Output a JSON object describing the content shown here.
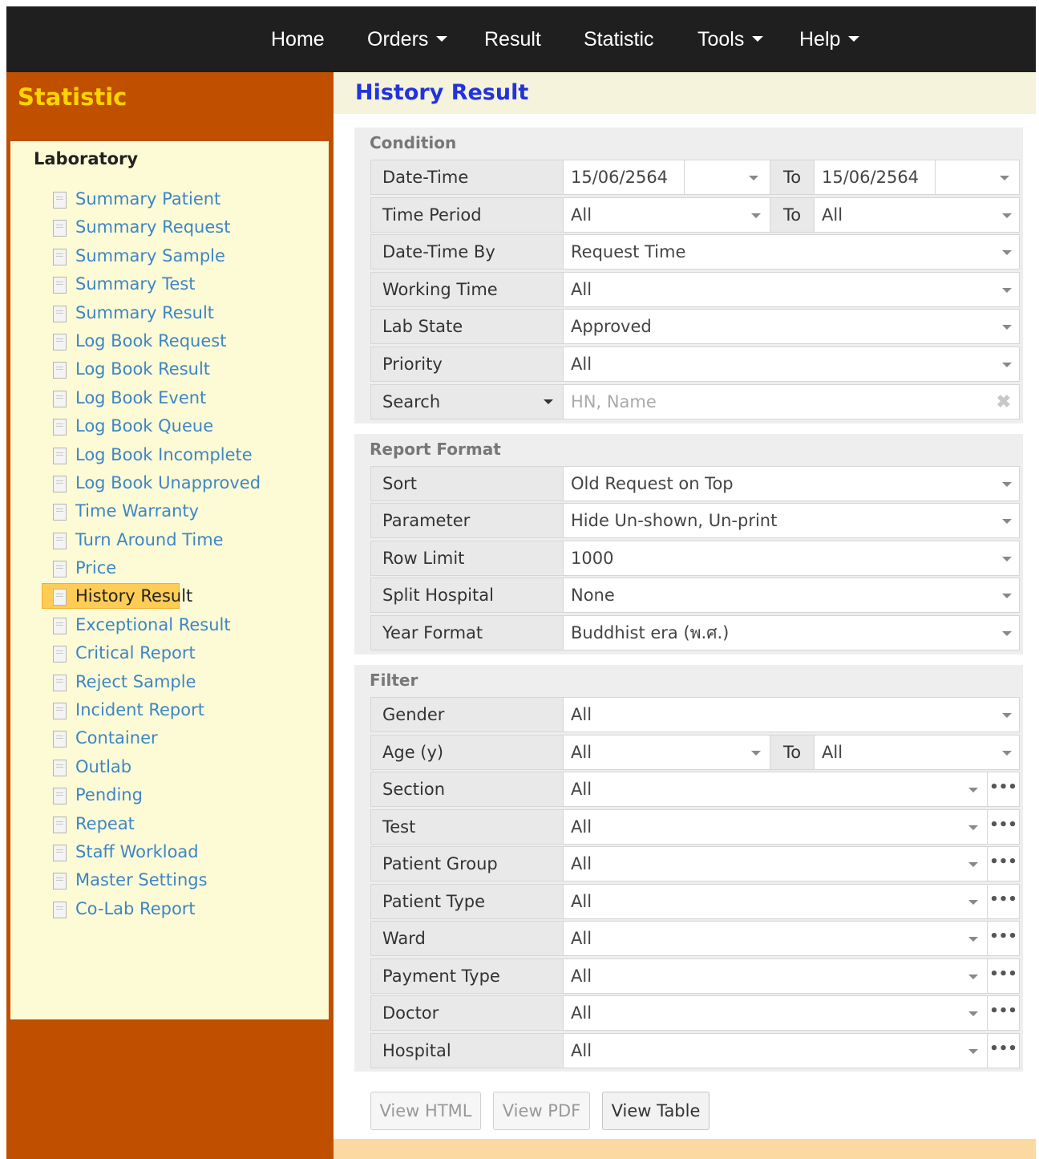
{
  "nav": {
    "items": [
      {
        "label": "Home",
        "has_menu": false
      },
      {
        "label": "Orders",
        "has_menu": true
      },
      {
        "label": "Result",
        "has_menu": false
      },
      {
        "label": "Statistic",
        "has_menu": false
      },
      {
        "label": "Tools",
        "has_menu": true
      },
      {
        "label": "Help",
        "has_menu": true
      }
    ]
  },
  "sidebar": {
    "title": "Statistic",
    "group_title": "Laboratory",
    "items": [
      {
        "label": "Summary Patient"
      },
      {
        "label": "Summary Request"
      },
      {
        "label": "Summary Sample"
      },
      {
        "label": "Summary Test"
      },
      {
        "label": "Summary Result"
      },
      {
        "label": "Log Book Request"
      },
      {
        "label": "Log Book Result"
      },
      {
        "label": "Log Book Event"
      },
      {
        "label": "Log Book Queue"
      },
      {
        "label": "Log Book Incomplete"
      },
      {
        "label": "Log Book Unapproved"
      },
      {
        "label": "Time Warranty"
      },
      {
        "label": "Turn Around Time"
      },
      {
        "label": "Price"
      },
      {
        "label": "History Result",
        "active": true
      },
      {
        "label": "Exceptional Result"
      },
      {
        "label": "Critical Report"
      },
      {
        "label": "Reject Sample"
      },
      {
        "label": "Incident Report"
      },
      {
        "label": "Container"
      },
      {
        "label": "Outlab"
      },
      {
        "label": "Pending"
      },
      {
        "label": "Repeat"
      },
      {
        "label": "Staff Workload"
      },
      {
        "label": "Master Settings"
      },
      {
        "label": "Co-Lab Report"
      }
    ]
  },
  "main": {
    "title": "History Result",
    "condition": {
      "title": "Condition",
      "date_time": {
        "label": "Date-Time",
        "from": "15/06/2564",
        "to_label": "To",
        "to": "15/06/2564"
      },
      "time_period": {
        "label": "Time Period",
        "from": "All",
        "to_label": "To",
        "to": "All"
      },
      "date_time_by": {
        "label": "Date-Time By",
        "value": "Request Time"
      },
      "working_time": {
        "label": "Working Time",
        "value": "All"
      },
      "lab_state": {
        "label": "Lab State",
        "value": "Approved"
      },
      "priority": {
        "label": "Priority",
        "value": "All"
      },
      "search": {
        "label": "Search",
        "placeholder": "HN, Name",
        "clear": "✖"
      }
    },
    "report_format": {
      "title": "Report Format",
      "sort": {
        "label": "Sort",
        "value": "Old Request on Top"
      },
      "parameter": {
        "label": "Parameter",
        "value": "Hide Un-shown, Un-print"
      },
      "row_limit": {
        "label": "Row Limit",
        "value": "1000"
      },
      "split_hospital": {
        "label": "Split Hospital",
        "value": "None"
      },
      "year_format": {
        "label": "Year Format",
        "value": "Buddhist era (พ.ศ.)"
      }
    },
    "filter": {
      "title": "Filter",
      "gender": {
        "label": "Gender",
        "value": "All"
      },
      "age": {
        "label": "Age (y)",
        "from": "All",
        "to_label": "To",
        "to": "All"
      },
      "more_glyph": "•••",
      "rows": [
        {
          "label": "Section",
          "value": "All"
        },
        {
          "label": "Test",
          "value": "All"
        },
        {
          "label": "Patient Group",
          "value": "All"
        },
        {
          "label": "Patient Type",
          "value": "All"
        },
        {
          "label": "Ward",
          "value": "All"
        },
        {
          "label": "Payment Type",
          "value": "All"
        },
        {
          "label": "Doctor",
          "value": "All"
        },
        {
          "label": "Hospital",
          "value": "All"
        }
      ]
    },
    "buttons": {
      "view_html": "View HTML",
      "view_pdf": "View PDF",
      "view_table": "View Table"
    }
  },
  "colors": {
    "navbar_bg": "#1f1f1f",
    "sidebar_bg": "#c04f00",
    "sidebar_title": "#ffd400",
    "sidebar_panel": "#fdfbd6",
    "link": "#3d86c6",
    "active_highlight": "#ffcc55",
    "page_title": "#2233dd"
  }
}
